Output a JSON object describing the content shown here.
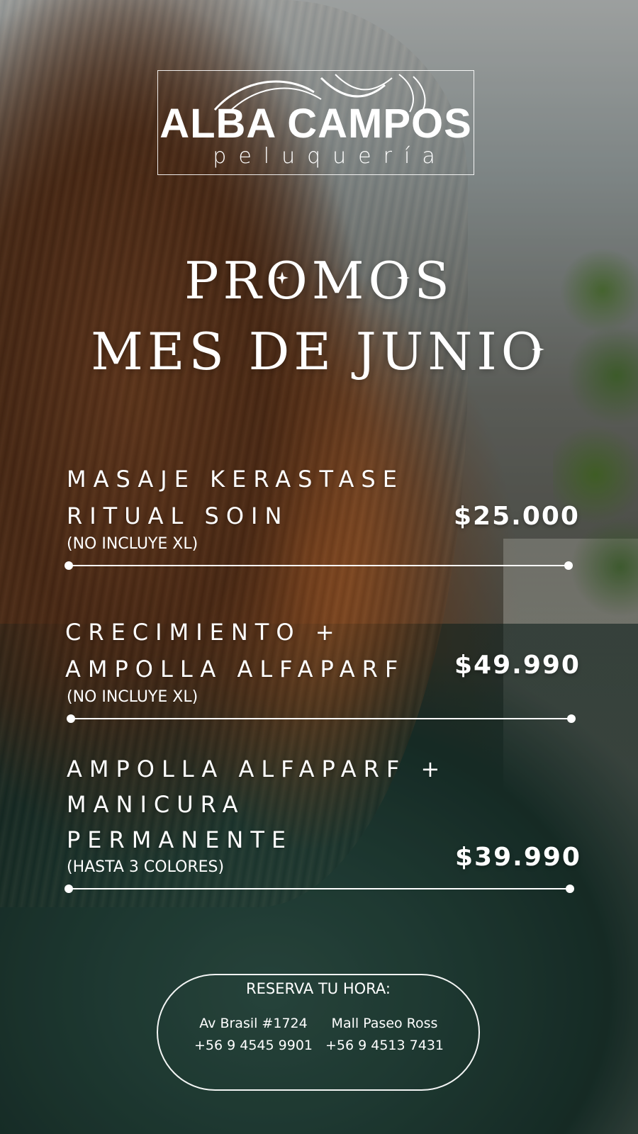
{
  "logo": {
    "name": "ALBA CAMPOS",
    "subtitle": "peluquería"
  },
  "headline": {
    "line1": "PROMOS",
    "line2": "MES DE JUNIO"
  },
  "promos": [
    {
      "name_line1": "MASAJE KERASTASE",
      "name_line2": "RITUAL SOIN",
      "note": "(NO INCLUYE XL)",
      "price": "$25.000"
    },
    {
      "name_line1": "CRECIMIENTO +",
      "name_line2": "AMPOLLA ALFAPARF",
      "note": "(NO INCLUYE XL)",
      "price": "$49.990"
    },
    {
      "name_line1": "AMPOLLA ALFAPARF +",
      "name_line2": "MANICURA",
      "name_line3": "PERMANENTE",
      "note": "(HASTA 3 COLORES)",
      "price": "$39.990"
    }
  ],
  "contact": {
    "title": "RESERVA TU HORA:",
    "locations": [
      {
        "address": "Av Brasil #1724",
        "phone": "+56 9 4545 9901"
      },
      {
        "address": "Mall Paseo Ross",
        "phone": "+56 9 4513 7431"
      }
    ]
  },
  "colors": {
    "text": "#ffffff",
    "hair": "#7a4520",
    "sweater": "#24443b"
  }
}
